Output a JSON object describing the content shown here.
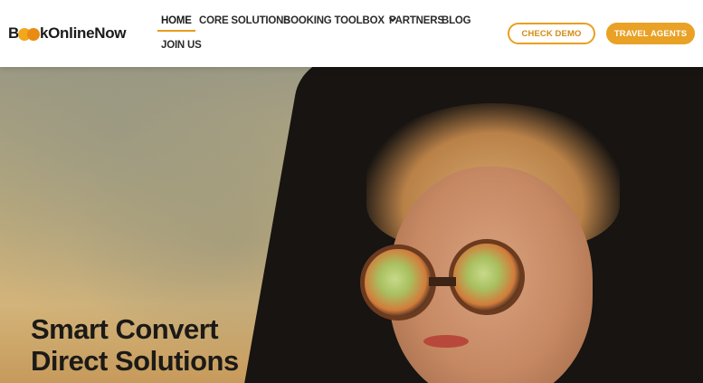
{
  "brand": {
    "logo_prefix": "B",
    "logo_suffix": "kOnlineNow"
  },
  "nav": {
    "items": [
      {
        "label": "HOME",
        "active": true
      },
      {
        "label": "CORE SOLUTIONS"
      },
      {
        "label": "BOOKING TOOLBOX",
        "has_dropdown": true
      },
      {
        "label": "PARTNERS"
      },
      {
        "label": "BLOG"
      },
      {
        "label": "JOIN US"
      }
    ]
  },
  "cta": {
    "check_demo": "CHECK DEMO",
    "travel_agents": "TRAVEL AGENTS"
  },
  "hero": {
    "title_line1": "Smart Convert",
    "title_line2": "Direct Solutions"
  },
  "colors": {
    "accent": "#e9a126",
    "text": "#1f1f1f"
  },
  "icons": {
    "dropdown": "chevron-down-icon"
  }
}
